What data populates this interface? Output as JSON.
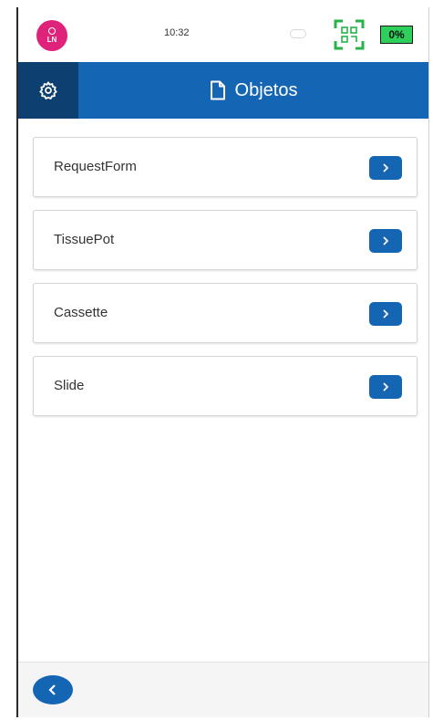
{
  "status": {
    "avatar_initials": "LN",
    "time": "10:32",
    "battery": "0%"
  },
  "header": {
    "title": "Objetos"
  },
  "objects": [
    {
      "label": "RequestForm"
    },
    {
      "label": "TissuePot"
    },
    {
      "label": "Cassette"
    },
    {
      "label": "Slide"
    }
  ],
  "colors": {
    "primary": "#1565b5",
    "header_dark": "#0d3f70",
    "avatar": "#e0237a",
    "battery": "#2fcf5c"
  },
  "icons": {
    "settings": "gear-icon",
    "title": "document-icon",
    "item_action": "chevron-right-icon",
    "back": "chevron-left-icon",
    "scan": "qr-scan-icon",
    "link": "link-icon"
  }
}
